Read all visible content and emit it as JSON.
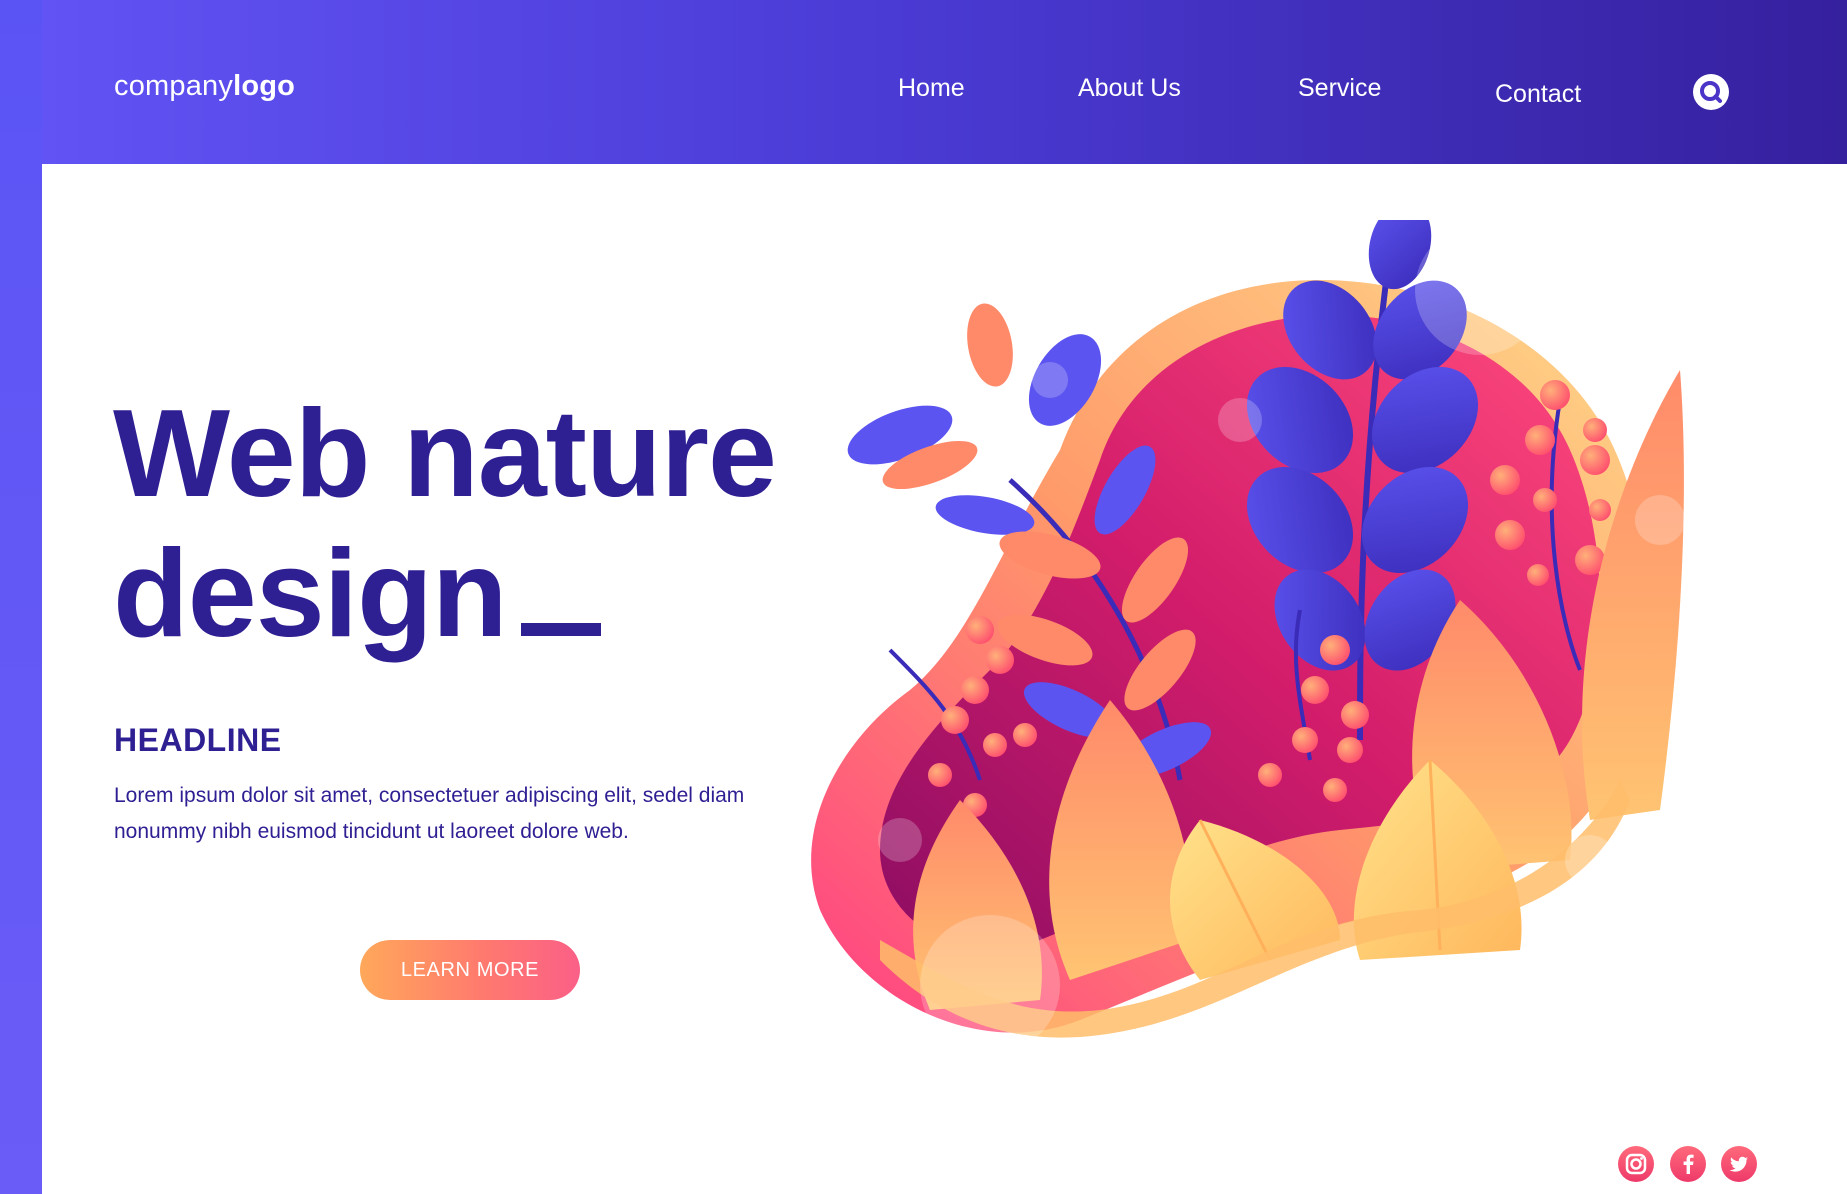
{
  "header": {
    "logo_light": "company",
    "logo_bold": "logo",
    "nav": [
      {
        "label": "Home"
      },
      {
        "label": "About Us"
      },
      {
        "label": "Service"
      },
      {
        "label": "Contact"
      }
    ],
    "search_icon": "search-icon"
  },
  "hero": {
    "title_line1": "Web nature",
    "title_line2": "design",
    "headline": "HEADLINE",
    "body": "Lorem ipsum dolor sit amet, consectetuer adipiscing elit, sedel diam nonummy nibh euismod tincidunt ut laoreet dolore web.",
    "cta_label": "LEARN MORE"
  },
  "social": [
    {
      "icon": "instagram-icon"
    },
    {
      "icon": "facebook-icon"
    },
    {
      "icon": "twitter-icon"
    }
  ],
  "colors": {
    "header_start": "#6153f4",
    "header_end": "#35209e",
    "title": "#2e1f93",
    "accent_pink": "#ee3a6a",
    "accent_orange": "#ffa85a"
  }
}
